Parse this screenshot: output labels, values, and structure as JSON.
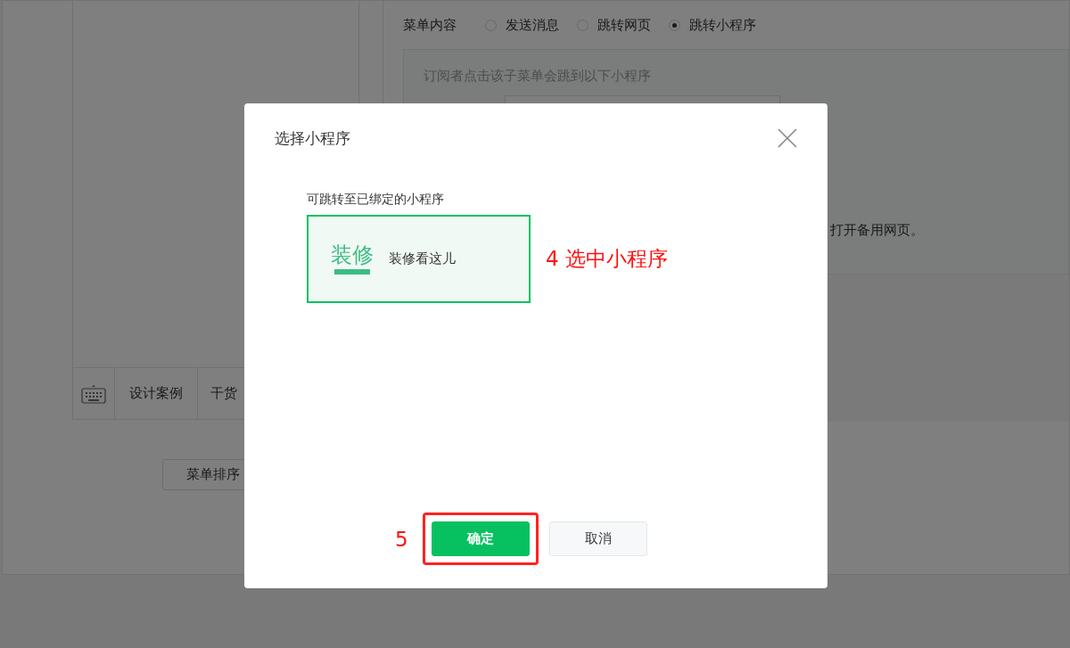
{
  "background": {
    "menu_content": {
      "label": "菜单内容",
      "options": [
        {
          "label": "发送消息",
          "selected": false
        },
        {
          "label": "跳转网页",
          "selected": false
        },
        {
          "label": "跳转小程序",
          "selected": true
        }
      ]
    },
    "hint": "订阅者点击该子菜单会跳到以下小程序",
    "fallback_note": "打开备用网页。",
    "preview_menu": [
      {
        "kind": "keyboard"
      },
      {
        "kind": "item",
        "label": "设计案例"
      },
      {
        "kind": "item",
        "label": "干货"
      }
    ],
    "sort_button": "菜单排序"
  },
  "dialog": {
    "title": "选择小程序",
    "subtitle": "可跳转至已绑定的小程序",
    "programs": [
      {
        "logo_text": "装修",
        "name": "装修看这儿",
        "selected": true
      }
    ],
    "buttons": [
      {
        "label": "确定",
        "kind": "primary"
      },
      {
        "label": "取消",
        "kind": "default"
      }
    ]
  },
  "annotations": [
    {
      "label": "4 选中小程序"
    },
    {
      "label": "5"
    }
  ]
}
